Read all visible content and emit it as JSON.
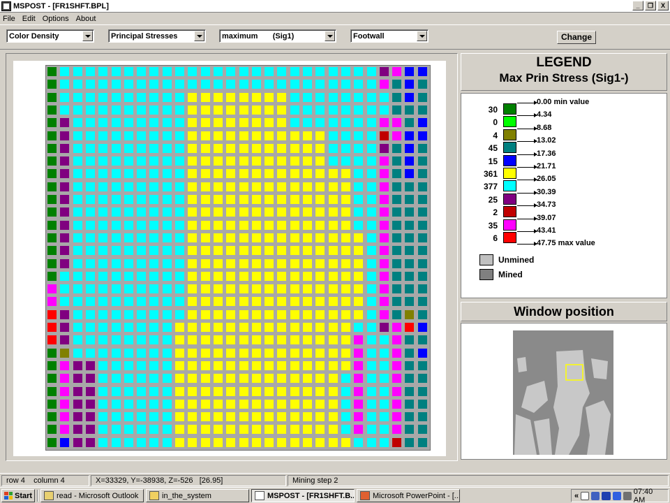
{
  "window": {
    "title": "MSPOST - [FR1SHFT.BPL]",
    "buttons": [
      "_",
      "❐",
      "X"
    ]
  },
  "menu": [
    "File",
    "Edit",
    "Options",
    "About"
  ],
  "toolbar": {
    "dropdowns": [
      {
        "value": "Color Density"
      },
      {
        "value": "Principal Stresses"
      },
      {
        "value": "maximum       (Sig1)"
      },
      {
        "value": "Footwall"
      }
    ],
    "change_label": "Change"
  },
  "legend": {
    "title": "LEGEND",
    "subtitle": "Max Prin Stress (Sig1-)",
    "boundaries": [
      "0.00 min value",
      "4.34",
      "8.68",
      "13.02",
      "17.36",
      "21.71",
      "26.05",
      "30.39",
      "34.73",
      "39.07",
      "43.41",
      "47.75 max value"
    ],
    "bins": [
      {
        "count": "30",
        "color": "#008000"
      },
      {
        "count": "0",
        "color": "#00ff00"
      },
      {
        "count": "4",
        "color": "#808000"
      },
      {
        "count": "45",
        "color": "#008080"
      },
      {
        "count": "15",
        "color": "#0000ff"
      },
      {
        "count": "361",
        "color": "#ffff00"
      },
      {
        "count": "377",
        "color": "#00ffff"
      },
      {
        "count": "25",
        "color": "#800080"
      },
      {
        "count": "2",
        "color": "#c00000"
      },
      {
        "count": "35",
        "color": "#ff00ff"
      },
      {
        "count": "6",
        "color": "#ff0000"
      }
    ],
    "unmined_label": "Unmined",
    "mined_label": "Mined",
    "unmined_color": "#c0c0c0",
    "mined_color": "#808080"
  },
  "window_position": {
    "title": "Window position"
  },
  "status": {
    "cell": "row 4    column 4",
    "coords": "X=33329, Y=-38938, Z=-526   [26.95]",
    "step": "Mining step 2"
  },
  "taskbar": {
    "start": "Start",
    "tasks": [
      {
        "label": "read - Microsoft Outlook"
      },
      {
        "label": "in_the_system"
      },
      {
        "label": "MSPOST - [FR1SHFT.B..."
      },
      {
        "label": "Microsoft PowerPoint - [..."
      }
    ],
    "clock": "07:40 AM"
  }
}
